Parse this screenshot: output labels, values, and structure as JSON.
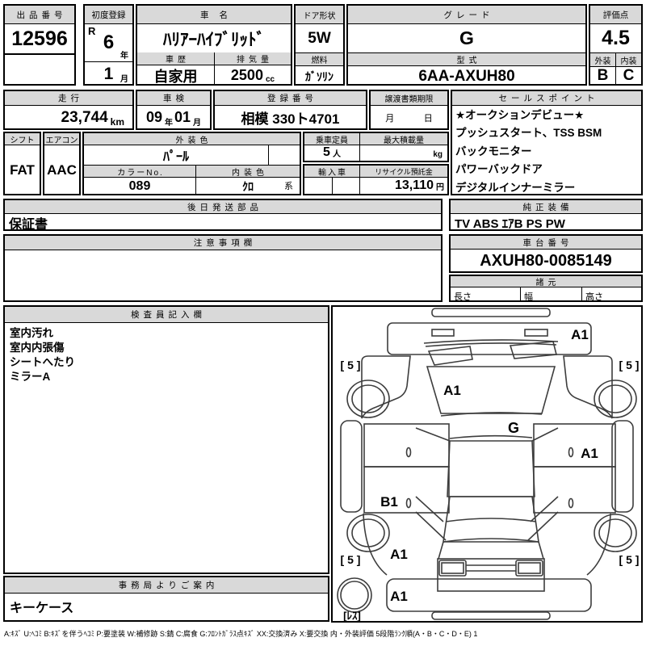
{
  "header": {
    "lot_no": {
      "label": "出品番号",
      "value": "12596"
    },
    "first_registration": {
      "label": "初度登録",
      "era": "R",
      "year": "6",
      "year_unit": "年",
      "month": "1",
      "month_unit": "月"
    },
    "car_name": {
      "label": "車 名",
      "value": "ﾊﾘｱｰﾊｲﾌﾞﾘｯﾄﾞ"
    },
    "door_shape": {
      "label": "ドア形状",
      "value": "5W"
    },
    "grade": {
      "label": "グレード",
      "value": "G"
    },
    "score": {
      "label": "評価点",
      "value": "4.5"
    },
    "history": {
      "label": "車歴",
      "value": "自家用"
    },
    "displacement": {
      "label": "排気量",
      "value": "2500",
      "unit": "cc"
    },
    "fuel": {
      "label": "燃料",
      "value": "ｶﾞｿﾘﾝ"
    },
    "model_code": {
      "label": "型式",
      "value": "6AA-AXUH80"
    },
    "exterior": {
      "label": "外装",
      "value": "B"
    },
    "interior": {
      "label": "内装",
      "value": "C"
    }
  },
  "details": {
    "mileage": {
      "label": "走行",
      "value": "23,744",
      "unit": "km"
    },
    "inspection": {
      "label": "車検",
      "year": "09",
      "year_unit": "年",
      "month": "01",
      "month_unit": "月"
    },
    "registration_no": {
      "label": "登録番号",
      "value": "相模 330ト4701"
    },
    "transfer_deadline": {
      "label": "譲渡書類期限",
      "month_unit": "月",
      "day_unit": "日"
    },
    "shift": {
      "label": "シフト",
      "value": "FAT"
    },
    "aircon": {
      "label": "エアコン",
      "value": "AAC"
    },
    "exterior_color": {
      "label": "外装色",
      "value": "ﾊﾟｰﾙ"
    },
    "color_no": {
      "label": "カラーNo.",
      "value": "089"
    },
    "interior_color": {
      "label": "内装色",
      "value": "ｸﾛ",
      "suffix": "系"
    },
    "capacity": {
      "label": "乗車定員",
      "value": "5",
      "unit": "人"
    },
    "max_load": {
      "label": "最大積載量",
      "unit": "kg"
    },
    "import_car": {
      "label": "輸入車",
      "value": ""
    },
    "recycle_deposit": {
      "label": "リサイクル預託金",
      "value": "13,110",
      "unit": "円"
    }
  },
  "sales_points": {
    "label": "セールスポイント",
    "lines": [
      "★オークションデビュー★",
      "プッシュスタート、TSS BSM",
      "バックモニター",
      "パワーバックドア",
      "デジタルインナーミラー"
    ]
  },
  "later_shipping": {
    "label": "後日発送部品",
    "value": "保証書"
  },
  "genuine_equipment": {
    "label": "純正装備",
    "value": "TV ABS ｴｱB PS PW"
  },
  "caution": {
    "label": "注意事項欄",
    "value": ""
  },
  "chassis_no": {
    "label": "車台番号",
    "value": "AXUH80-0085149"
  },
  "specs": {
    "label": "諸元",
    "length_label": "長さ",
    "width_label": "幅",
    "height_label": "高さ"
  },
  "inspector_notes": {
    "label": "検査員記入欄",
    "lines": [
      "室内汚れ",
      "室内内張傷",
      "シートへたり",
      "ミラーA"
    ]
  },
  "office_notice": {
    "label": "事務局よりご案内",
    "value": "キーケース"
  },
  "diagram": {
    "marks": {
      "rear_bumper": "A1",
      "rear_wheel_left": "[ 5 ]",
      "rear_wheel_right": "[ 5 ]",
      "rear_glass": "A1",
      "roof": "G",
      "door_right": "A1",
      "door_left": "B1",
      "fender_left": "A1",
      "front_wheel_left": "[ 5 ]",
      "front_wheel_right": "[ 5 ]",
      "front_bumper": "A1",
      "spare_tire": "[ﾚｽ]"
    }
  },
  "legend": "A:ｷｽﾞ U:ﾍｺﾐ B:ｷｽﾞを伴うﾍｺﾐ P:要塗装 W:補修跡 S:錆 C:腐食 G:ﾌﾛﾝﾄｶﾞﾗｽ点ｷｽﾞ XX:交換済み X:要交換  内・外装評価 5段階ﾗﾝｸ順(A・B・C・D・E) 1",
  "colors": {
    "header_bg": "#d9d9d9",
    "border": "#000000",
    "diagram_line": "#3d3d3d"
  }
}
